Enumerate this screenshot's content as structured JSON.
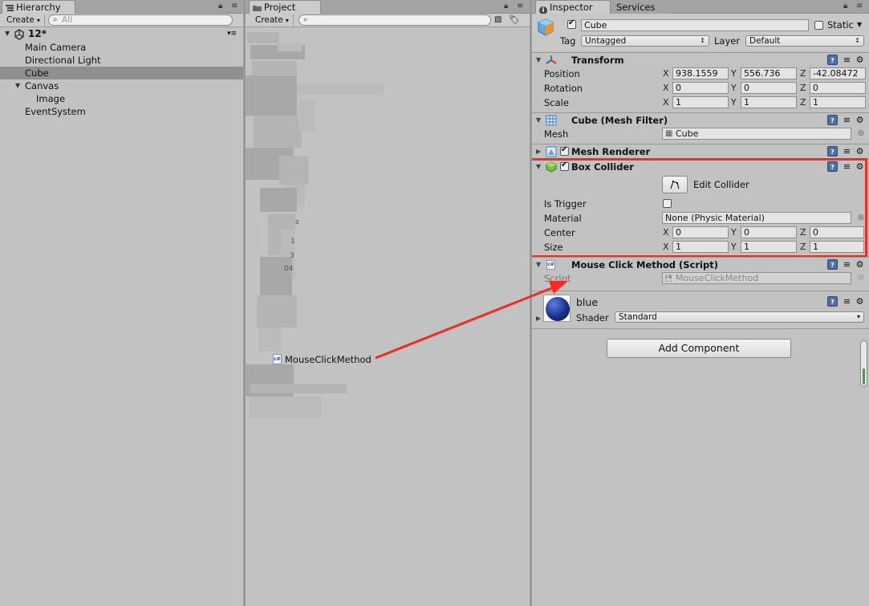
{
  "colors": {
    "highlight": "#f22c22",
    "arrow": "#f22c22",
    "selection": "#8f8f8f",
    "panel_bg": "#c2c2c2"
  },
  "hierarchy": {
    "tab_label": "Hierarchy",
    "tab_icon": "list-icon",
    "create_label": "Create",
    "search_placeholder": "All",
    "scene_name": "12*",
    "items": [
      {
        "label": "Main Camera"
      },
      {
        "label": "Directional Light"
      },
      {
        "label": "Cube"
      },
      {
        "label": "Canvas"
      },
      {
        "label": "Image"
      },
      {
        "label": "EventSystem"
      }
    ]
  },
  "project": {
    "tab_label": "Project",
    "tab_icon": "folder-icon",
    "create_label": "Create",
    "search_placeholder": "",
    "fragments": {
      "f1": "s",
      "f2": "1",
      "f3": "3",
      "f4": "04"
    },
    "script_item": {
      "label": "MouseClickMethod",
      "icon": "cs-script-icon"
    }
  },
  "inspector": {
    "tab_label": "Inspector",
    "tab_icon": "info-icon",
    "services_tab": "Services",
    "object": {
      "name": "Cube",
      "active": true,
      "static_label": "Static",
      "tag_label": "Tag",
      "tag_value": "Untagged",
      "layer_label": "Layer",
      "layer_value": "Default"
    },
    "transform": {
      "title": "Transform",
      "rows": [
        {
          "label": "Position",
          "x": "938.1559",
          "y": "556.736",
          "z": "-42.08472"
        },
        {
          "label": "Rotation",
          "x": "0",
          "y": "0",
          "z": "0"
        },
        {
          "label": "Scale",
          "x": "1",
          "y": "1",
          "z": "1"
        }
      ]
    },
    "axes": {
      "x": "X",
      "y": "Y",
      "z": "Z"
    },
    "mesh_filter": {
      "title": "Cube (Mesh Filter)",
      "mesh_label": "Mesh",
      "mesh_value": "Cube"
    },
    "mesh_renderer": {
      "title": "Mesh Renderer",
      "enabled": true
    },
    "box_collider": {
      "title": "Box Collider",
      "enabled": true,
      "edit_label": "Edit Collider",
      "is_trigger_label": "Is Trigger",
      "is_trigger": false,
      "material_label": "Material",
      "material_value": "None (Physic Material)",
      "center_label": "Center",
      "center": {
        "x": "0",
        "y": "0",
        "z": "0"
      },
      "size_label": "Size",
      "size": {
        "x": "1",
        "y": "1",
        "z": "1"
      }
    },
    "script_component": {
      "title": "Mouse Click Method (Script)",
      "script_label": "Script",
      "script_value": "MouseClickMethod"
    },
    "material": {
      "name": "blue",
      "shader_label": "Shader",
      "shader_value": "Standard"
    },
    "add_component_label": "Add Component"
  }
}
